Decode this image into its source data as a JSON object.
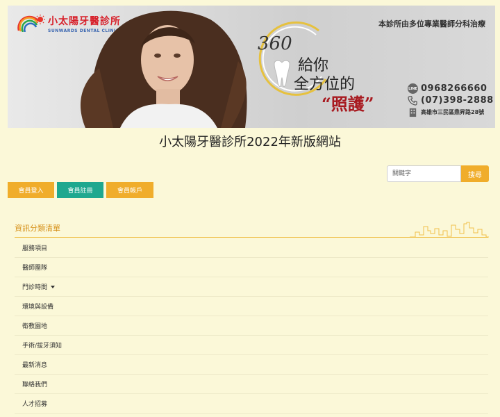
{
  "banner": {
    "logo": {
      "name": "小太陽牙醫診所",
      "subtitle": "SUNWARDS DENTAL CLINIC"
    },
    "tagline": "本診所由多位專業醫師分科治療",
    "slogan": {
      "number": "360",
      "line1": "給你",
      "line2": "全方位的",
      "line3": "“照護”"
    },
    "contact": {
      "line_id": "0968266660",
      "phone": "(07)398-2888",
      "address": "高雄市三民區鼎昇路28號"
    }
  },
  "site_title": "小太陽牙醫診所2022年新版網站",
  "search": {
    "placeholder": "關鍵字",
    "button_label": "搜尋"
  },
  "member_buttons": {
    "login": "會員登入",
    "register": "會員註冊",
    "account": "會員帳戶"
  },
  "category": {
    "title": "資訊分類清單",
    "items": [
      {
        "label": "服務項目"
      },
      {
        "label": "醫師團隊"
      },
      {
        "label": "門診時間"
      },
      {
        "label": "環境與設備"
      },
      {
        "label": "衛教園地"
      },
      {
        "label": "手術/拔牙須知"
      },
      {
        "label": "最新消息"
      },
      {
        "label": "聯絡我們"
      },
      {
        "label": "人才招募"
      }
    ]
  },
  "colors": {
    "background": "#fbf8d8",
    "accent_orange": "#f0ad2b",
    "accent_teal": "#1fa88f",
    "category_title": "#d69018",
    "brand_red": "#d7202a"
  },
  "icons": {
    "logo": "sun-rainbow-logo-icon",
    "line": "line-app-icon",
    "phone": "phone-icon",
    "address": "building-icon",
    "dropdown": "caret-down-icon"
  }
}
